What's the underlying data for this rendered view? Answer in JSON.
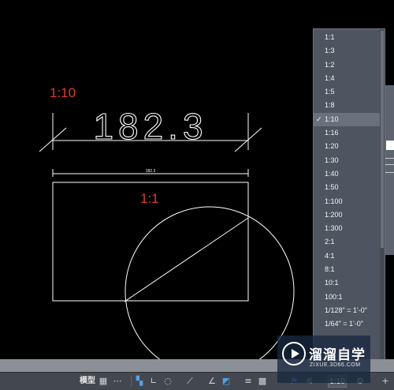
{
  "drawing": {
    "annotation_large": "1:10",
    "annotation_small": "1:1",
    "dimension_large": "182.3",
    "dimension_small": "182.3"
  },
  "scale_menu": {
    "items": [
      "1:1",
      "1:3",
      "1:2",
      "1:4",
      "1:5",
      "1:8",
      "1:10",
      "1:16",
      "1:20",
      "1:30",
      "1:40",
      "1:50",
      "1:100",
      "1:200",
      "1:300",
      "2:1",
      "4:1",
      "8:1",
      "10:1",
      "100:1",
      "1/128\" = 1'-0\"",
      "1/64\" = 1'-0\""
    ],
    "selected": "1:10",
    "check_mark": "✓"
  },
  "status_bar": {
    "model_tab": "模型",
    "annotation_scale": "1:10"
  },
  "watermark": {
    "title": "溜溜自学",
    "url": "ZIXUE.3D66.COM"
  },
  "colors": {
    "annotation_red": "#e03a2e",
    "drawing_lines": "#ffffff",
    "menu_bg": "#4f5560",
    "menu_selected": "#6a717c",
    "statusbar_bg": "#434850"
  },
  "icons": [
    "grid-icon",
    "snap-icon",
    "ortho-icon",
    "polar-icon",
    "osnap-icon",
    "otrack-icon",
    "lineweight-icon",
    "transparency-icon",
    "annotation-visibility-icon",
    "auto-scale-icon",
    "workspace-gear-icon",
    "add-icon"
  ]
}
